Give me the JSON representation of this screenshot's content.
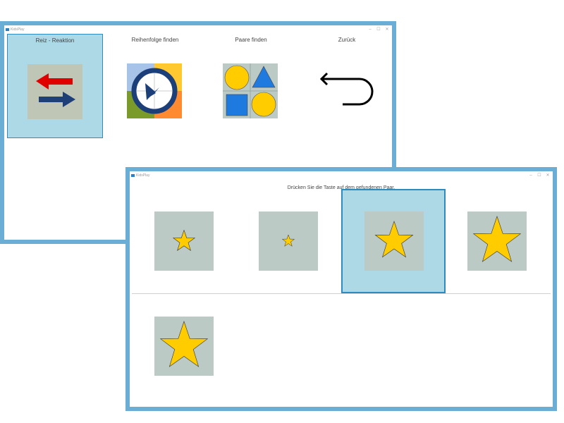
{
  "colors": {
    "window_border": "#6aaed6",
    "selected_bg": "#add8e6",
    "selected_border": "#2e8bc0",
    "card_bg": "#bccac6",
    "star_fill": "#ffcc00"
  },
  "menu_window": {
    "title": "KidsPlay",
    "controls": {
      "minimize": "–",
      "maximize": "☐",
      "close": "✕"
    },
    "tiles": [
      {
        "label": "Reiz - Reaktion",
        "icon": "arrows-icon",
        "selected": true
      },
      {
        "label": "Reihenfolge finden",
        "icon": "clock-icon",
        "selected": false
      },
      {
        "label": "Paare finden",
        "icon": "shapes-icon",
        "selected": false
      },
      {
        "label": "Zurück",
        "icon": "back-arrow-icon",
        "selected": false
      }
    ]
  },
  "pairs_window": {
    "title": "KidsPlay",
    "controls": {
      "minimize": "–",
      "maximize": "☐",
      "close": "✕"
    },
    "instruction": "Drücken Sie die Taste auf dem gefundenen Paar.",
    "options": [
      {
        "icon": "star-icon",
        "size": "small",
        "selected": false
      },
      {
        "icon": "star-icon",
        "size": "tiny",
        "selected": false
      },
      {
        "icon": "star-icon",
        "size": "medium",
        "selected": true
      },
      {
        "icon": "star-icon",
        "size": "large",
        "selected": false
      }
    ],
    "target": {
      "icon": "star-icon",
      "size": "large"
    }
  }
}
